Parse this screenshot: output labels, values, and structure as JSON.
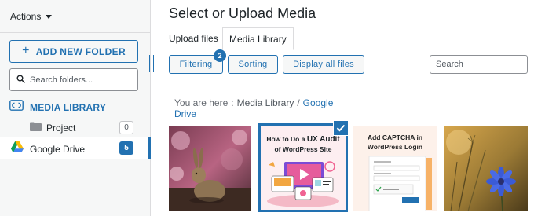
{
  "sidebar": {
    "actions_label": "Actions",
    "add_folder_label": "ADD NEW FOLDER",
    "search_placeholder": "Search folders...",
    "media_library_label": "MEDIA LIBRARY",
    "folders": [
      {
        "label": "Project",
        "count": "0"
      },
      {
        "label": "Google Drive",
        "count": "5"
      }
    ]
  },
  "main": {
    "title": "Select or Upload Media",
    "tabs": [
      {
        "label": "Upload files",
        "active": false
      },
      {
        "label": "Media Library",
        "active": true
      }
    ],
    "toolbar": {
      "filtering_label": "Filtering",
      "filtering_badge": "2",
      "sorting_label": "Sorting",
      "display_all_label": "Display all files",
      "search_placeholder": "Search"
    },
    "breadcrumb": {
      "prefix": "You are here",
      "separator": ":",
      "items": [
        "Media Library",
        "Google Drive"
      ],
      "item_separator": "/"
    },
    "thumbnails": [
      {
        "name": "rabbit-photo",
        "selected": false
      },
      {
        "name": "ux-audit-graphic",
        "selected": true,
        "line1_a": "How to Do a ",
        "line1_b": "UX Audit",
        "line2": "of WordPress Site"
      },
      {
        "name": "captcha-graphic",
        "selected": false,
        "line1": "Add CAPTCHA in",
        "line2": "WordPress Login"
      },
      {
        "name": "cornflower-photo",
        "selected": false
      }
    ]
  },
  "colors": {
    "accent": "#2271b1",
    "sidebar_bg": "#f6f7f7",
    "text": "#1d2327"
  }
}
